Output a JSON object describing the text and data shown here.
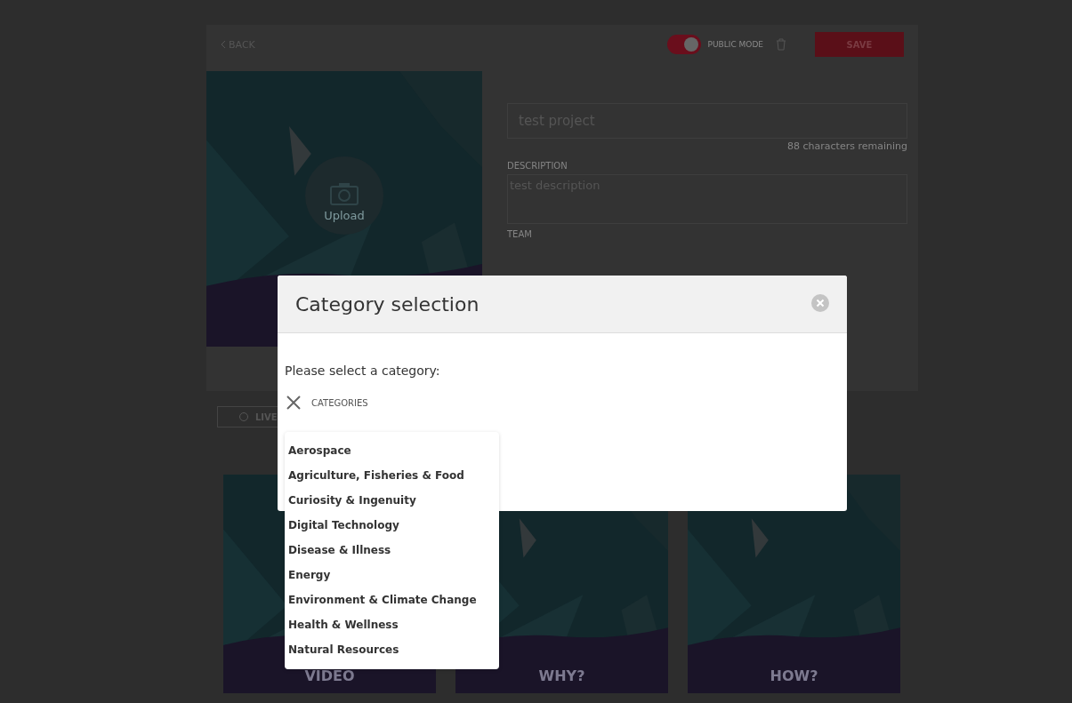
{
  "header": {
    "back": "BACK",
    "public_mode": {
      "label": "PUBLIC MODE",
      "on": true
    },
    "save": "SAVE"
  },
  "cover": {
    "kind": "picture",
    "upload": "Upload"
  },
  "form": {
    "title_value": "test project",
    "counter": "88 characters remaining",
    "description_label": "DESCRIPTION",
    "description_value": "test description",
    "team_label": "TEAM"
  },
  "live_button": {
    "label": "LIVE",
    "selected": false
  },
  "cards": [
    {
      "kind": "picture",
      "label": "VIDEO"
    },
    {
      "kind": "picture",
      "label": "WHY?"
    },
    {
      "kind": "picture",
      "label": "HOW?"
    }
  ],
  "modal": {
    "title": "Category selection",
    "prompt": "Please select a category:",
    "field_label": "CATEGORIES",
    "options": [
      {
        "label": "Aerospace",
        "selected": false
      },
      {
        "label": "Agriculture, Fisheries & Food",
        "selected": false
      },
      {
        "label": "Curiosity & Ingenuity",
        "selected": false
      },
      {
        "label": "Digital Technology",
        "selected": false
      },
      {
        "label": "Disease & Illness",
        "selected": false
      },
      {
        "label": "Energy",
        "selected": false
      },
      {
        "label": "Environment & Climate Change",
        "selected": false
      },
      {
        "label": "Health & Wellness",
        "selected": false
      },
      {
        "label": "Natural Resources",
        "selected": false
      }
    ]
  }
}
